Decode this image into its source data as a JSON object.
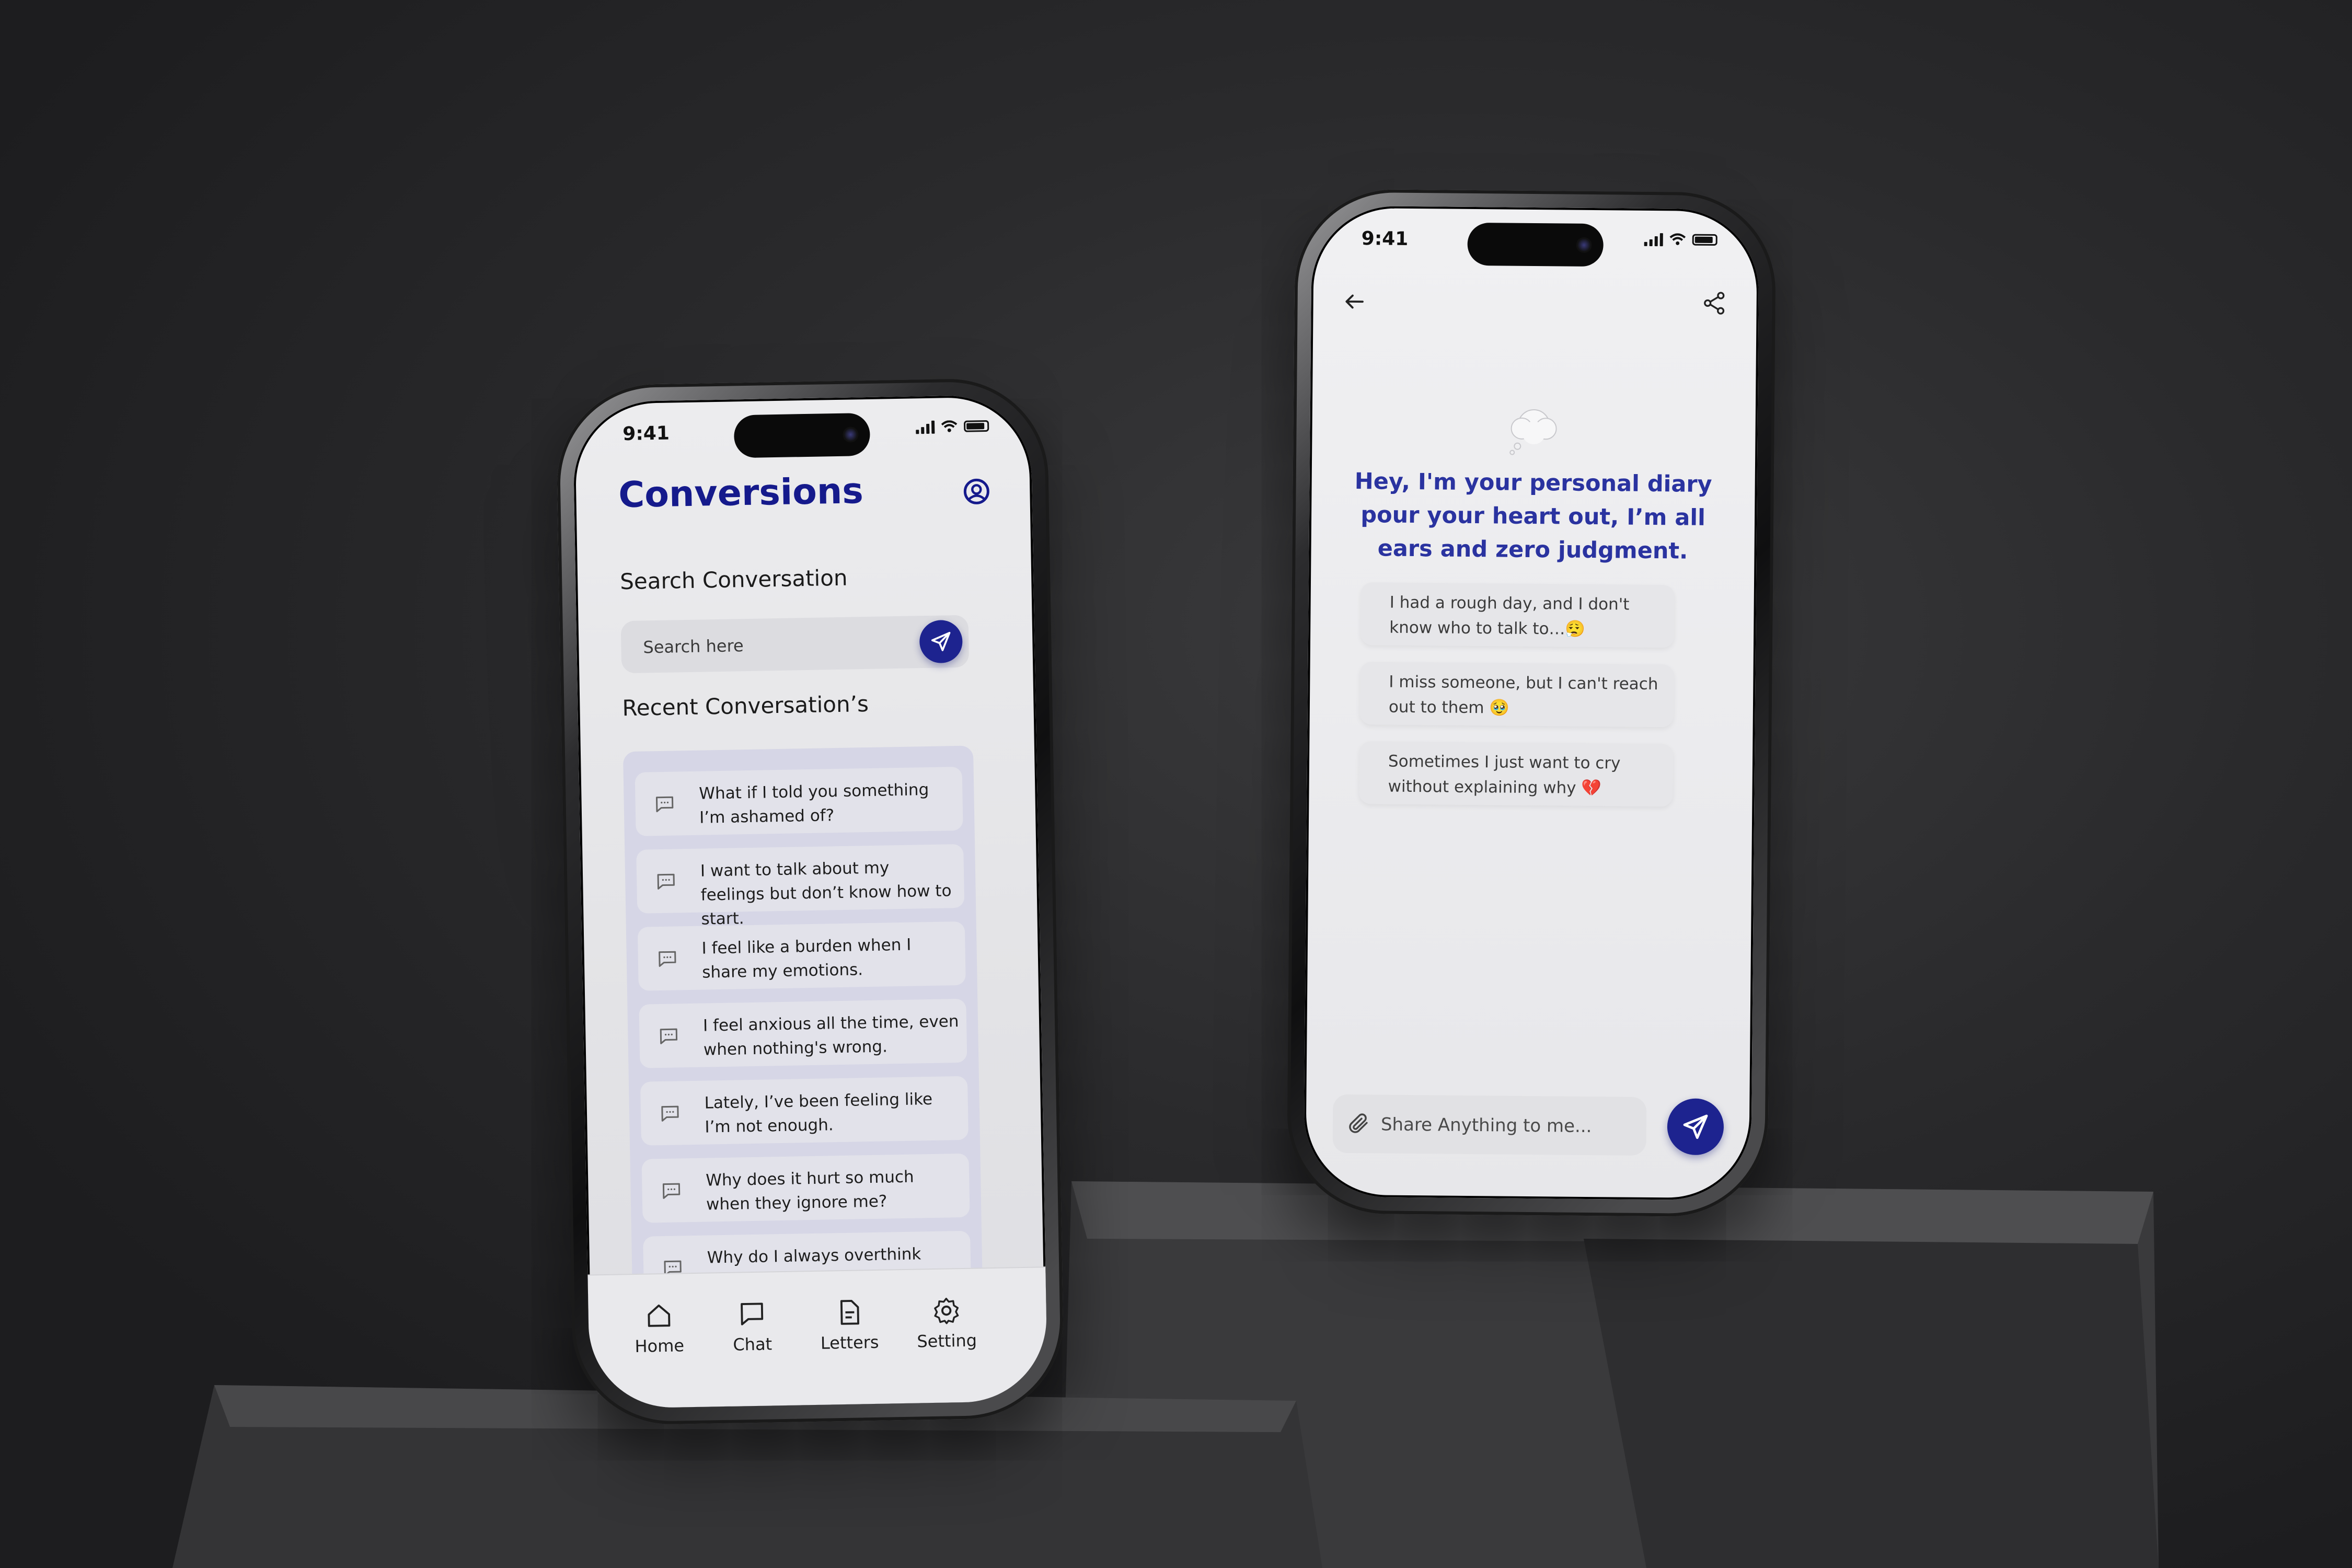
{
  "left_phone": {
    "status_time": "9:41",
    "app_title": "Conversions",
    "search_label": "Search Conversation",
    "search_placeholder": "Search here",
    "recent_label": "Recent Conversation’s",
    "conversations": [
      "What if I told you something I’m ashamed of?",
      "I want to talk about my feelings but don’t know how to start.",
      "I feel like a burden when I share my emotions.",
      "I feel anxious all the time, even when nothing's wrong.",
      "Lately, I’ve been feeling like I’m not enough.",
      "Why does it hurt so much when they ignore me?",
      "Why do I always overthink everything?"
    ],
    "tabs": [
      "Home",
      "Chat",
      "Letters",
      "Setting"
    ]
  },
  "right_phone": {
    "status_time": "9:41",
    "hero_text": "Hey, I'm your personal diary pour your heart out, I’m all ears and zero judgment.",
    "suggestions": [
      "I had a rough day, and I don't know who to talk to…😮‍💨",
      "I miss someone, but I can't reach out to them 🥹",
      "Sometimes I just want to cry without explaining why 💔"
    ],
    "composer_placeholder": "Share Anything to me..."
  },
  "colors": {
    "accent": "#1d238f",
    "heading": "#151a8c",
    "hero": "#2a33a0",
    "screen_bg": "#ececee",
    "list_panel": "#d6d6e6"
  },
  "icons": [
    "profile-icon",
    "send-icon",
    "chat-bubble-icon",
    "home-icon",
    "chat-icon",
    "letters-icon",
    "gear-icon",
    "back-arrow-icon",
    "share-icon",
    "thought-cloud-icon",
    "paperclip-icon"
  ]
}
